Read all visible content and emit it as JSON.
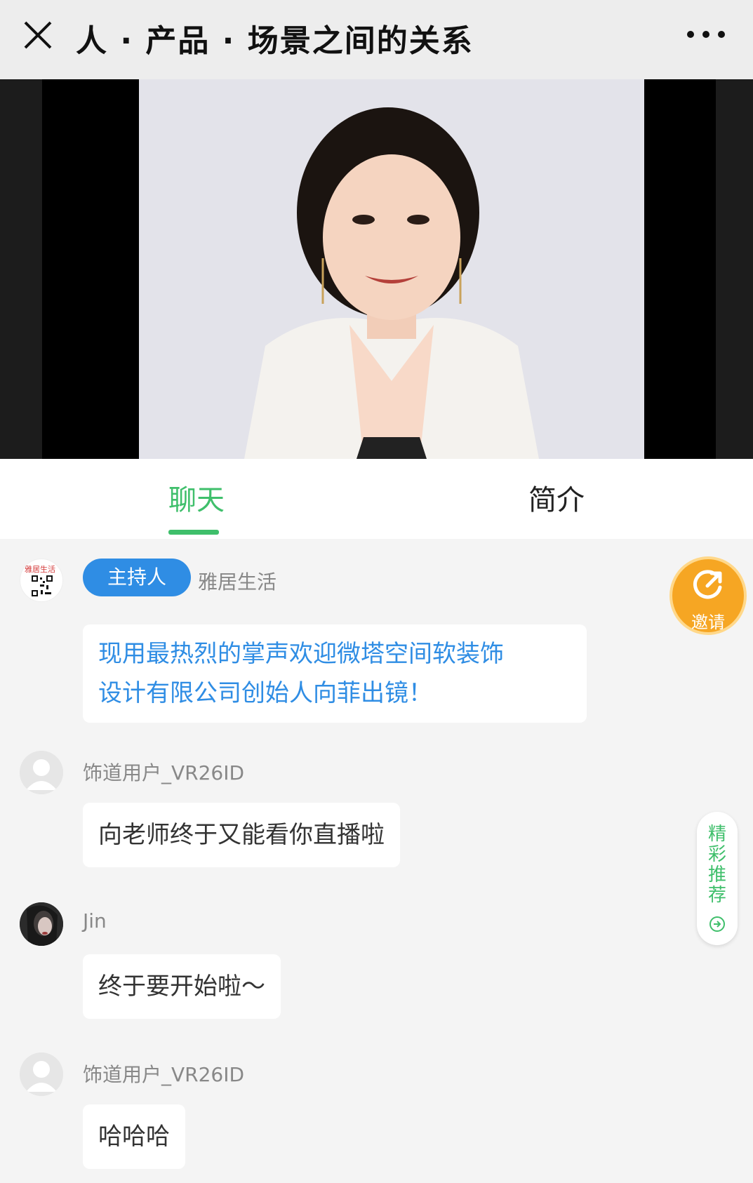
{
  "header": {
    "title": "人 · 产品 · 场景之间的关系",
    "close_icon": "close-icon",
    "more_icon": "more-icon"
  },
  "tabs": [
    {
      "label": "聊天",
      "active": true
    },
    {
      "label": "简介",
      "active": false
    }
  ],
  "colors": {
    "accent_green": "#3fbf6b",
    "host_blue": "#2f8de4",
    "invite_orange": "#f6a623"
  },
  "messages": [
    {
      "badge": "主持人",
      "name": "雅居生活",
      "avatar_logo_text": "雅居生活",
      "text_line1": "现用最热烈的掌声欢迎微塔空间软装饰",
      "text_line2": "设计有限公司创始人向菲出镜！"
    },
    {
      "name": "饰道用户_VR26ID",
      "text": "向老师终于又能看你直播啦"
    },
    {
      "name": "Jin",
      "text": "终于要开始啦～"
    },
    {
      "name": "饰道用户_VR26ID",
      "text": "哈哈哈"
    }
  ],
  "floating": {
    "invite_label": "邀请",
    "recommend_label": "精彩推荐"
  }
}
